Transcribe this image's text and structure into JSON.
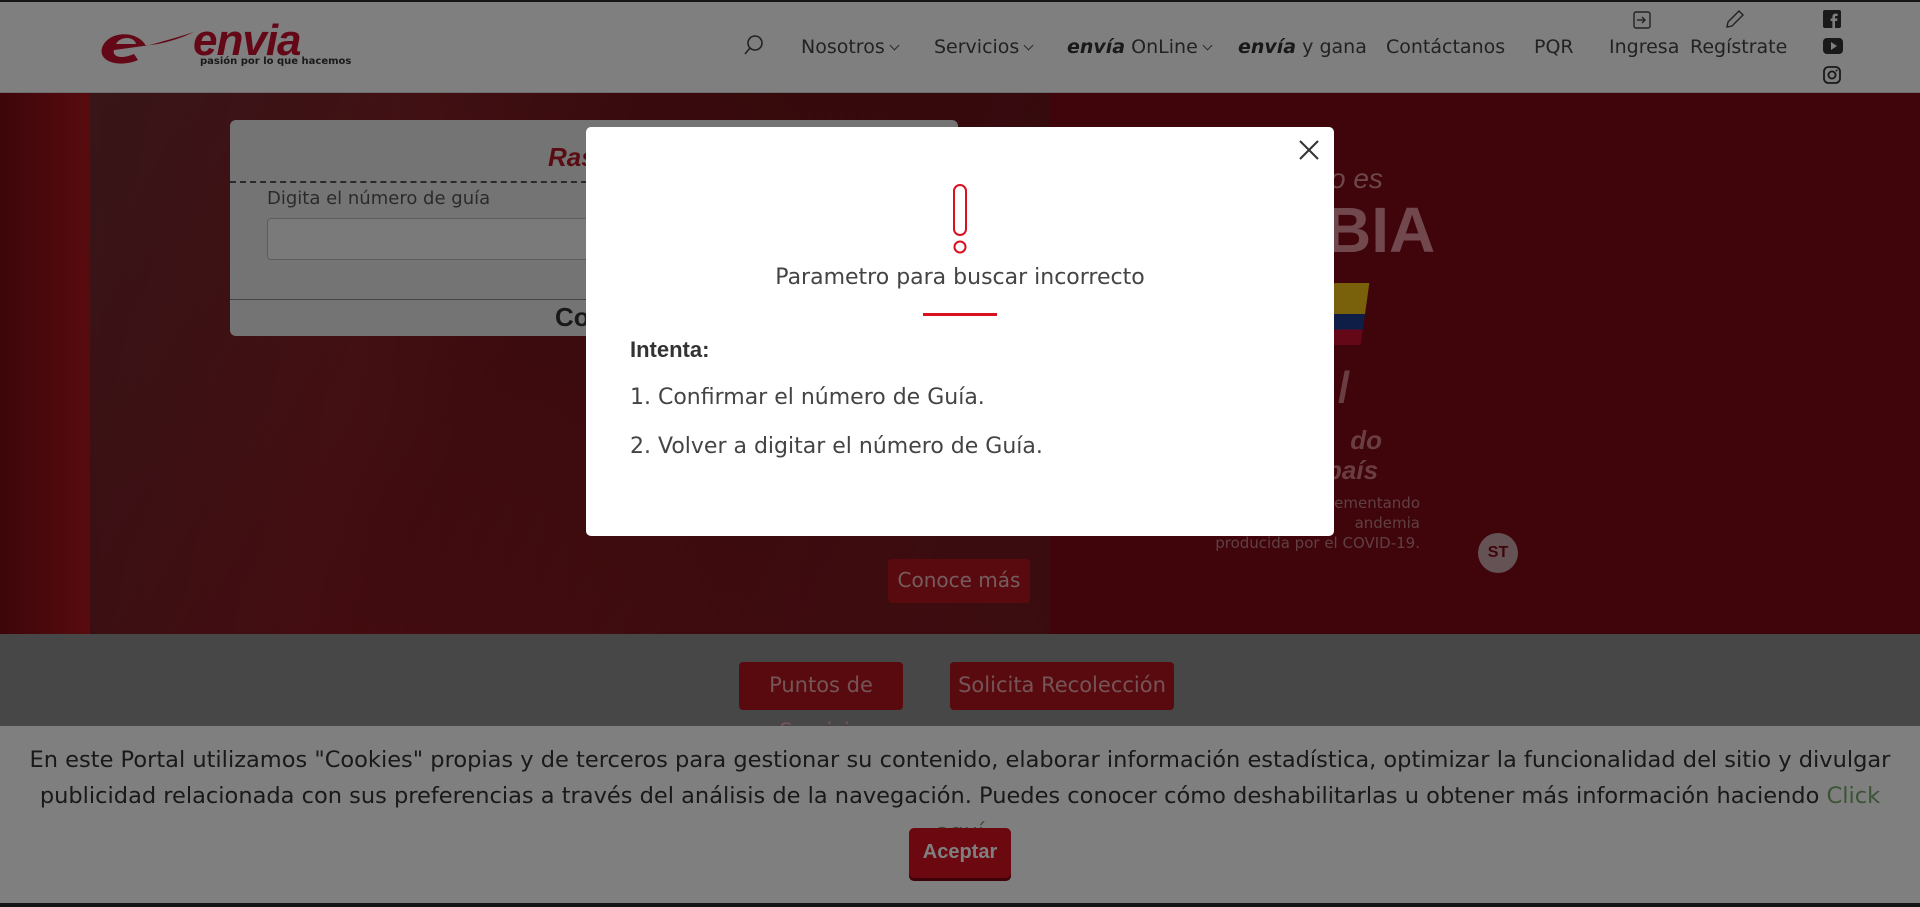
{
  "header": {
    "logo_brand": "envia",
    "logo_tagline": "pasión por lo que hacemos",
    "nav": {
      "nosotros": "Nosotros",
      "servicios": "Servicios",
      "online_brand": "envía",
      "online_rest": " OnLine",
      "gana_brand": "envía",
      "gana_rest": " y gana",
      "contactanos": "Contáctanos",
      "pqr": "PQR",
      "ingresa": "Ingresa",
      "registrate": "Regístrate"
    }
  },
  "tracking": {
    "title": "Ras",
    "label": "Digita el número de guía",
    "button_partial": "Co"
  },
  "hero": {
    "line1": "o es",
    "line2": "BIA",
    "line3": "/",
    "line4a": "do",
    "line4b": "país",
    "small_text": "ementando\nandemia\nproducida por el COVID-19.",
    "st_logo": "ST",
    "conoce": "Conoce más"
  },
  "actions": {
    "puntos": "Puntos de Servicio",
    "recoleccion": "Solicita Recolección"
  },
  "cookie": {
    "text": "En este Portal utilizamos \"Cookies\" propias y de terceros para gestionar su contenido, elaborar información estadística, optimizar la funcionalidad del sitio y divulgar publicidad relacionada con sus preferencias a través del análisis de la navegación. Puedes conocer cómo deshabilitarlas u obtener más información haciendo ",
    "link": "Click aquí",
    "accept": "Aceptar"
  },
  "modal": {
    "title": "Parametro para buscar incorrecto",
    "intenta": "Intenta:",
    "step1": "1. Confirmar el número de Guía.",
    "step2": "2. Volver a digitar el número de Guía."
  },
  "icons": {
    "search": "search-icon",
    "close": "close-icon",
    "warning": "exclamation-icon",
    "facebook": "facebook-icon",
    "youtube": "youtube-icon",
    "instagram": "instagram-icon",
    "login": "login-icon",
    "register": "pencil-icon"
  },
  "colors": {
    "brand_red": "#d8101f",
    "hero_red": "#7e0a17",
    "link_green": "#78a86b"
  }
}
